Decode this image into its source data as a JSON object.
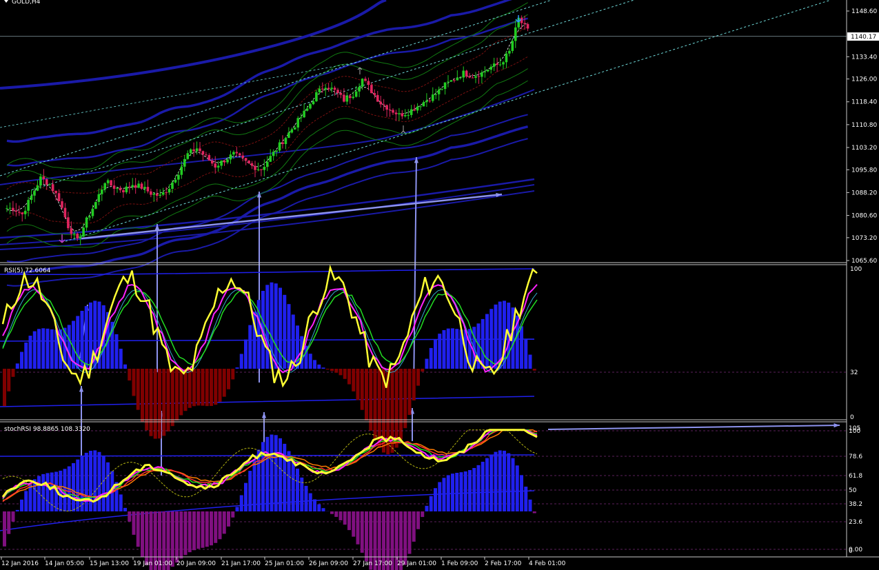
{
  "window": {
    "title": "GOLD,H4"
  },
  "colors": {
    "background": "#000000",
    "bull": "#22cc22",
    "bear": "#e0245e",
    "blue_band": "#1a1aa8",
    "green_band": "#117a11",
    "red_band": "#7a1010",
    "dash_cyan": "#6fd9d9",
    "arrow": "#8d93ee",
    "yellow": "#ffff33",
    "magenta": "#ff22ff",
    "green_line": "#22dd22",
    "cyan_line": "#33aacc",
    "orange": "#ff7a00",
    "hist_blue": "#2020ee",
    "hist_red": "#800000",
    "hist_purple": "#801080"
  },
  "chart_data": [
    {
      "type": "candlestick",
      "title": "GOLD,H4",
      "ylim": [
        1065.6,
        1152
      ],
      "price_ticks": [
        "1148.60",
        "1133.40",
        "1126.00",
        "1118.40",
        "1110.80",
        "1103.20",
        "1095.80",
        "1088.20",
        "1080.60",
        "1073.20",
        "1065.60"
      ],
      "current_price": "1140.17",
      "x_ticks": [
        "12 Jan 2016",
        "14 Jan 05:00",
        "15 Jan 13:00",
        "19 Jan 01:00",
        "20 Jan 09:00",
        "21 Jan 17:00",
        "25 Jan 01:00",
        "26 Jan 09:00",
        "27 Jan 17:00",
        "29 Jan 01:00",
        "1 Feb 09:00",
        "2 Feb 17:00",
        "4 Feb 01:00"
      ],
      "close_path": [
        1083,
        1081,
        1087,
        1093,
        1091,
        1086,
        1077,
        1072,
        1079,
        1085,
        1092,
        1090,
        1089,
        1091,
        1090,
        1088,
        1087,
        1090,
        1095,
        1101,
        1103,
        1100,
        1097,
        1099,
        1101,
        1099,
        1097,
        1096,
        1100,
        1104,
        1108,
        1112,
        1116,
        1121,
        1124,
        1122,
        1119,
        1121,
        1126,
        1122,
        1118,
        1116,
        1114,
        1115,
        1117,
        1119,
        1121,
        1124,
        1126,
        1128,
        1127,
        1128,
        1130,
        1131,
        1135,
        1146,
        1142
      ]
    },
    {
      "type": "line",
      "title": "RSI(5) 72.6064",
      "ylim": [
        0,
        100
      ],
      "levels": [
        "100",
        "32",
        "0"
      ]
    },
    {
      "type": "line",
      "title": "stochRSI 98.8865 108.3320",
      "ylim": [
        0,
        105
      ],
      "levels": [
        "105",
        "100",
        "78.6",
        "61.8",
        "50",
        "38.2",
        "23.6",
        "0.00",
        "0"
      ]
    }
  ]
}
